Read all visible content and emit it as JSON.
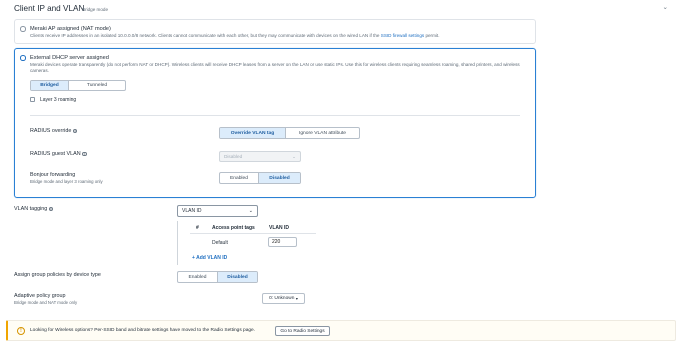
{
  "header": {
    "title": "Client IP and VLAN",
    "subtitle": "Bridge mode",
    "collapse_icon": "chevron-down-icon"
  },
  "nat_option": {
    "title": "Meraki AP assigned (NAT mode)",
    "description_pre": "Clients receive IP addresses in an isolated 10.0.0.0/8 network. Clients cannot communicate with each other, but they may communicate with devices on the wired LAN if the ",
    "description_link": "SSID firewall settings",
    "description_post": " permit.",
    "selected": false
  },
  "bridge_option": {
    "title": "External DHCP server assigned",
    "description": "Meraki devices operate transparently (do not perform NAT or DHCP). Wireless clients will receive DHCP leases from a server on the LAN or use static IPs. Use this for wireless clients requiring seamless roaming, shared printers, and wireless cameras.",
    "selected": true,
    "mode_segment": {
      "options": [
        "Bridged",
        "Tunneled"
      ],
      "selected": "Bridged"
    },
    "layer3_roaming": {
      "label": "Layer 3 roaming",
      "checked": false
    },
    "radius_override": {
      "label": "RADIUS override",
      "options": [
        "Override VLAN tag",
        "Ignore VLAN attribute"
      ],
      "selected": "Override VLAN tag"
    },
    "radius_guest_vlan": {
      "label": "RADIUS guest VLAN",
      "value": "Disabled",
      "disabled": true
    },
    "bonjour": {
      "label": "Bonjour forwarding",
      "sublabel": "Bridge mode and layer 3 roaming only",
      "options": [
        "Enabled",
        "Disabled"
      ],
      "selected": "Disabled"
    }
  },
  "vlan_tagging": {
    "label": "VLAN tagging",
    "value": "VLAN ID",
    "table": {
      "columns": [
        "#",
        "Access point tags",
        "VLAN ID"
      ],
      "rows": [
        {
          "num": "",
          "tags": "Default",
          "vlan_id": "220"
        }
      ]
    },
    "add_label": "+ Add VLAN ID"
  },
  "group_policies": {
    "label": "Assign group policies by device type",
    "options": [
      "Enabled",
      "Disabled"
    ],
    "selected": "Disabled"
  },
  "adaptive_policy": {
    "label": "Adaptive policy group",
    "sublabel": "Bridge mode and NAT mode only",
    "value": "0: Unknown"
  },
  "banner": {
    "text": "Looking for Wireless options? Per-SSID band and bitrate settings have moved to the Radio Settings page.",
    "button": "Go to Radio Settings",
    "icon": "warning-icon",
    "accent": "#f0a500"
  },
  "colors": {
    "selected_border": "#2a80d4",
    "link": "#1f6fc1",
    "active_segment_bg": "#dcecfb"
  }
}
